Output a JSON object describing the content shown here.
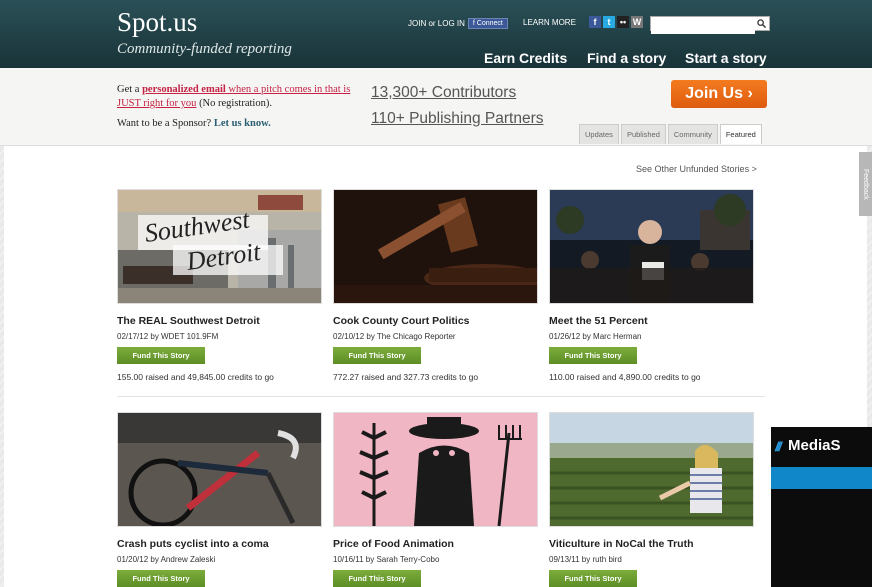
{
  "header": {
    "logo": "Spot.us",
    "tagline": "Community-funded reporting",
    "join_login": "JOIN or LOG IN",
    "fb_connect": "f Connect",
    "learn_more": "LEARN MORE",
    "nav": [
      "Earn Credits",
      "Find a story",
      "Start a story"
    ],
    "search_placeholder": ""
  },
  "promo": {
    "text1": "Get a ",
    "email_link": "personalized email",
    "text2": " when a pitch comes in that is JUST right for you",
    "text3": " (No registration).",
    "sponsor_text": "Want to be a Sponsor? ",
    "sponsor_link": "Let us know.",
    "contributors": "13,300+ Contributors",
    "partners": "110+ Publishing Partners",
    "join_button": "Join Us ›"
  },
  "tabs": [
    "Updates",
    "Published",
    "Community",
    "Featured"
  ],
  "active_tab": "Featured",
  "see_other": "See Other Unfunded Stories >",
  "fund_label": "Fund This Story",
  "stories": [
    {
      "title": "The REAL Southwest Detroit",
      "meta": "02/17/12 by WDET 101.9FM",
      "progress": "155.00 raised and 49,845.00 credits to go",
      "img_text": [
        "Southwest",
        "Detroit"
      ]
    },
    {
      "title": "Cook County Court Politics",
      "meta": "02/10/12 by The Chicago Reporter",
      "progress": "772.27 raised and 327.73 credits to go"
    },
    {
      "title": "Meet the 51 Percent",
      "meta": "01/26/12 by Marc Herman",
      "progress": "110.00 raised and 4,890.00 credits to go"
    },
    {
      "title": "Crash puts cyclist into a coma",
      "meta": "01/20/12 by Andrew Zaleski"
    },
    {
      "title": "Price of Food Animation",
      "meta": "10/16/11 by Sarah Terry-Cobo"
    },
    {
      "title": "Viticulture in NoCal the Truth",
      "meta": "09/13/11 by ruth bird"
    }
  ],
  "feedback": "Feedback",
  "ad": {
    "logo": "MediaS"
  },
  "colors": {
    "header": "#1f3f45",
    "accent": "#f47b20",
    "fund": "#6a9c2e",
    "link": "#c52244"
  }
}
